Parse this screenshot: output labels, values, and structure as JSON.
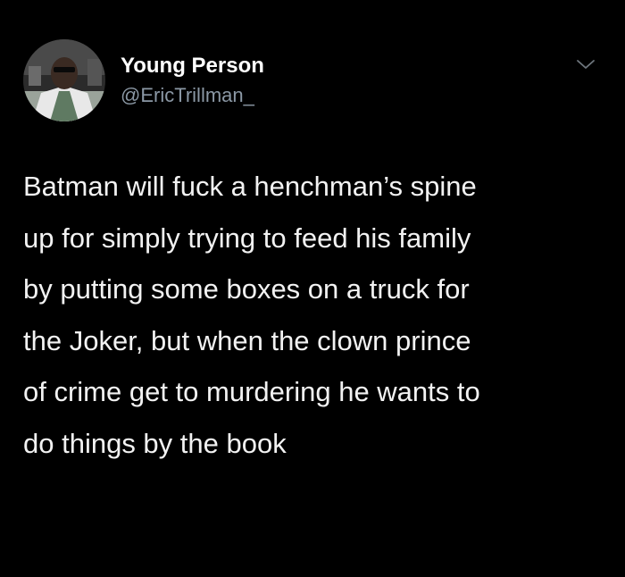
{
  "author": {
    "display_name": "Young Person",
    "handle": "@EricTrillman_",
    "avatar_icon": "profile-photo"
  },
  "more_icon": "chevron-down-icon",
  "tweet": {
    "text": "Batman will fuck a henchman’s spine\nup for simply trying to feed his family\nby putting some boxes on a truck for\nthe Joker, but when the clown prince\nof crime get to murdering he wants to\ndo things by the book"
  },
  "colors": {
    "background": "#000000",
    "text": "#f2f2f2",
    "handle": "#8b98a5"
  }
}
